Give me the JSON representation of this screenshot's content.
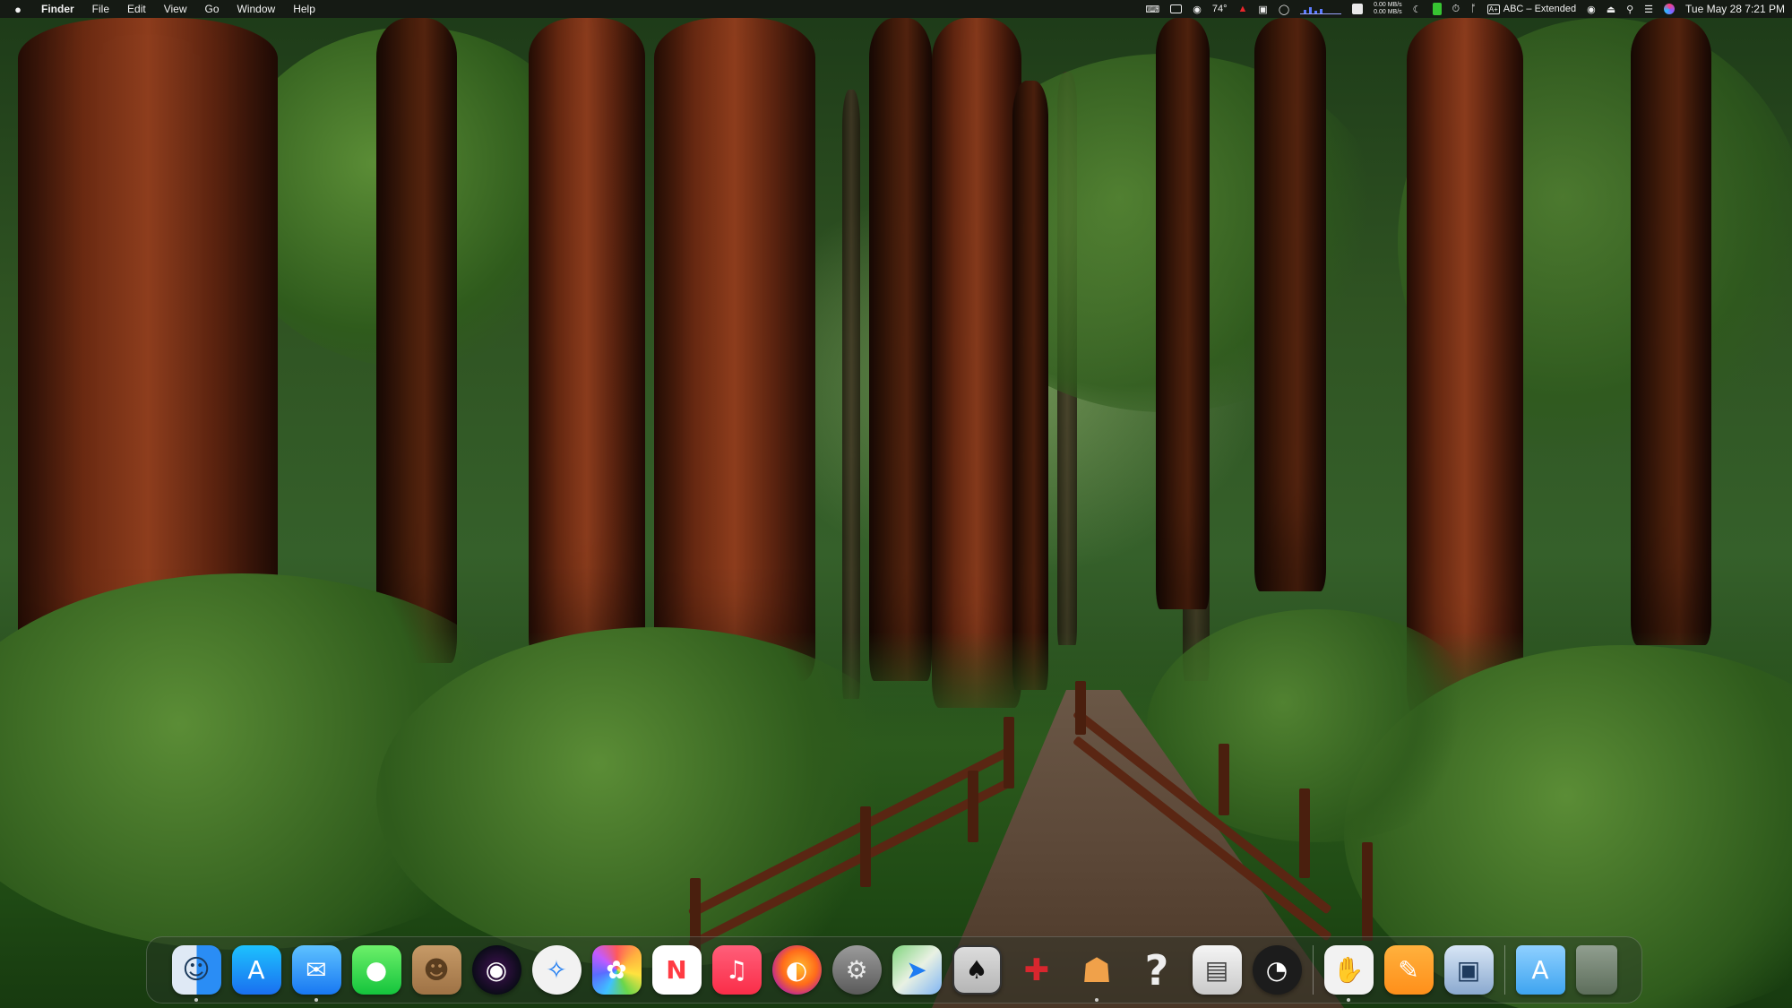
{
  "menubar": {
    "apple_icon": "apple-logo-icon",
    "app_name": "Finder",
    "menus": [
      "File",
      "Edit",
      "View",
      "Go",
      "Window",
      "Help"
    ],
    "status": {
      "temperature": "74°",
      "network_upload": "0.00 MB/s",
      "network_download": "0.00 MB/s",
      "input_source": "ABC – Extended",
      "datetime": "Tue May 28  7:21 PM"
    }
  },
  "dock": {
    "apps": [
      {
        "name": "Finder",
        "glyph": "☺",
        "icon": "finder-icon",
        "running": true
      },
      {
        "name": "App Store",
        "glyph": "A",
        "icon": "app-store-icon",
        "running": false
      },
      {
        "name": "Mail",
        "glyph": "✉",
        "icon": "mail-icon",
        "running": true
      },
      {
        "name": "Messages",
        "glyph": "●",
        "icon": "messages-icon",
        "running": false
      },
      {
        "name": "Contacts",
        "glyph": "☻",
        "icon": "contacts-icon",
        "running": false
      },
      {
        "name": "Siri",
        "glyph": "◉",
        "icon": "siri-icon",
        "running": false
      },
      {
        "name": "Safari",
        "glyph": "✧",
        "icon": "safari-icon",
        "running": false
      },
      {
        "name": "Photos",
        "glyph": "✿",
        "icon": "photos-icon",
        "running": false
      },
      {
        "name": "News",
        "glyph": "N",
        "icon": "news-icon",
        "running": false
      },
      {
        "name": "Music",
        "glyph": "♫",
        "icon": "music-icon",
        "running": false
      },
      {
        "name": "Firefox",
        "glyph": "◐",
        "icon": "firefox-icon",
        "running": false
      },
      {
        "name": "System Settings",
        "glyph": "⚙",
        "icon": "system-settings-icon",
        "running": false
      },
      {
        "name": "Maps",
        "glyph": "➤",
        "icon": "maps-icon",
        "running": false
      },
      {
        "name": "Solitaire",
        "glyph": "♠",
        "icon": "solitaire-icon",
        "running": false
      },
      {
        "name": "Games",
        "glyph": "✚",
        "icon": "games-icon",
        "running": false
      },
      {
        "name": "Migration Assistant",
        "glyph": "☗",
        "icon": "migration-assistant-icon",
        "running": true
      },
      {
        "name": "Help",
        "glyph": "?",
        "icon": "help-icon",
        "running": false
      },
      {
        "name": "Printer",
        "glyph": "▤",
        "icon": "printer-icon",
        "running": false
      },
      {
        "name": "Speed Test",
        "glyph": "◔",
        "icon": "speedometer-icon",
        "running": false
      }
    ],
    "apps_right": [
      {
        "name": "Stop",
        "glyph": "✋",
        "icon": "stop-hand-icon",
        "running": true
      },
      {
        "name": "Pages",
        "glyph": "✎",
        "icon": "pages-icon",
        "running": false
      },
      {
        "name": "Preview",
        "glyph": "▣",
        "icon": "preview-icon",
        "running": false
      }
    ],
    "stack": [
      {
        "name": "Applications",
        "glyph": "A",
        "icon": "applications-folder-icon"
      },
      {
        "name": "Trash",
        "glyph": "",
        "icon": "trash-icon"
      }
    ]
  },
  "colors": {
    "menubar_bg": "#141414",
    "accent_green": "#37c432",
    "warning_red": "#e8262b"
  }
}
